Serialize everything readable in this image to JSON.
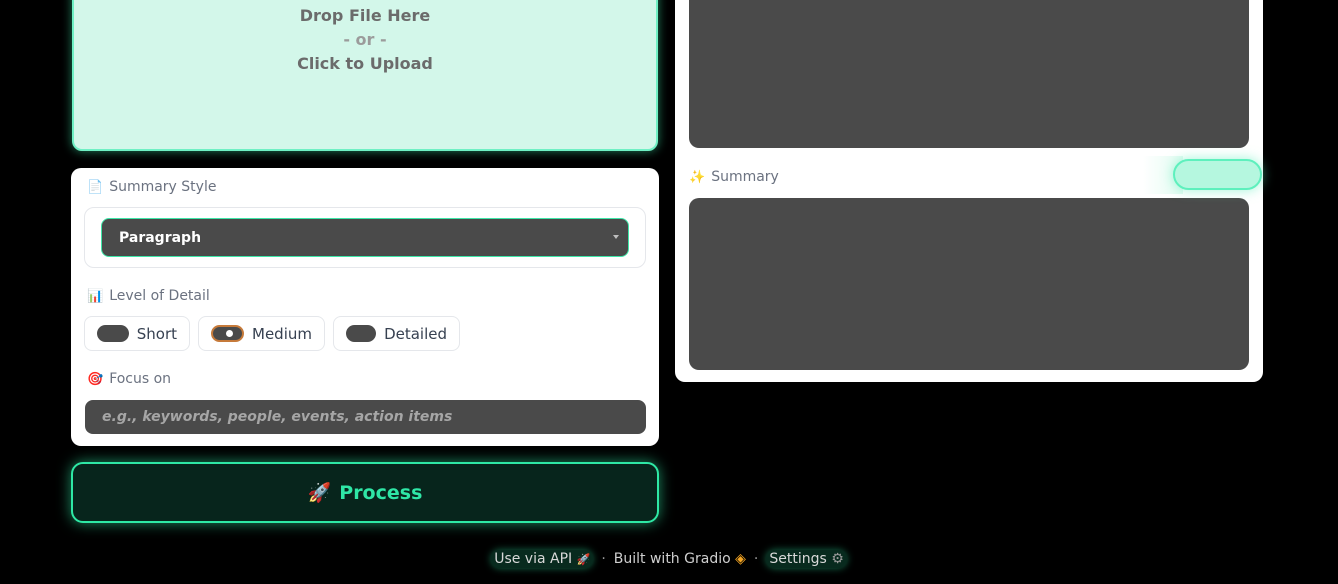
{
  "upload": {
    "line1": "Drop File Here",
    "line2": "- or -",
    "line3": "Click to Upload"
  },
  "options": {
    "summary_style_icon": "📄",
    "summary_style_label": "Summary Style",
    "summary_style_value": "Paragraph",
    "detail_icon": "📊",
    "detail_label": "Level of Detail",
    "detail_options": [
      "Short",
      "Medium",
      "Detailed"
    ],
    "detail_selected": "Medium",
    "focus_icon": "🎯",
    "focus_label": "Focus on",
    "focus_placeholder": "e.g., keywords, people, events, action items"
  },
  "process": {
    "icon": "🚀",
    "label": "Process"
  },
  "output": {
    "summary_icon": "✨",
    "summary_label": "Summary"
  },
  "footer": {
    "api": "Use via API",
    "api_icon": "🚀",
    "built": "Built with Gradio",
    "built_icon": "◈",
    "settings": "Settings",
    "settings_icon": "⚙"
  },
  "colors": {
    "accent": "#2ee8a5",
    "upload_bg": "#d3f7ea",
    "field_bg": "#4a4a4a"
  }
}
